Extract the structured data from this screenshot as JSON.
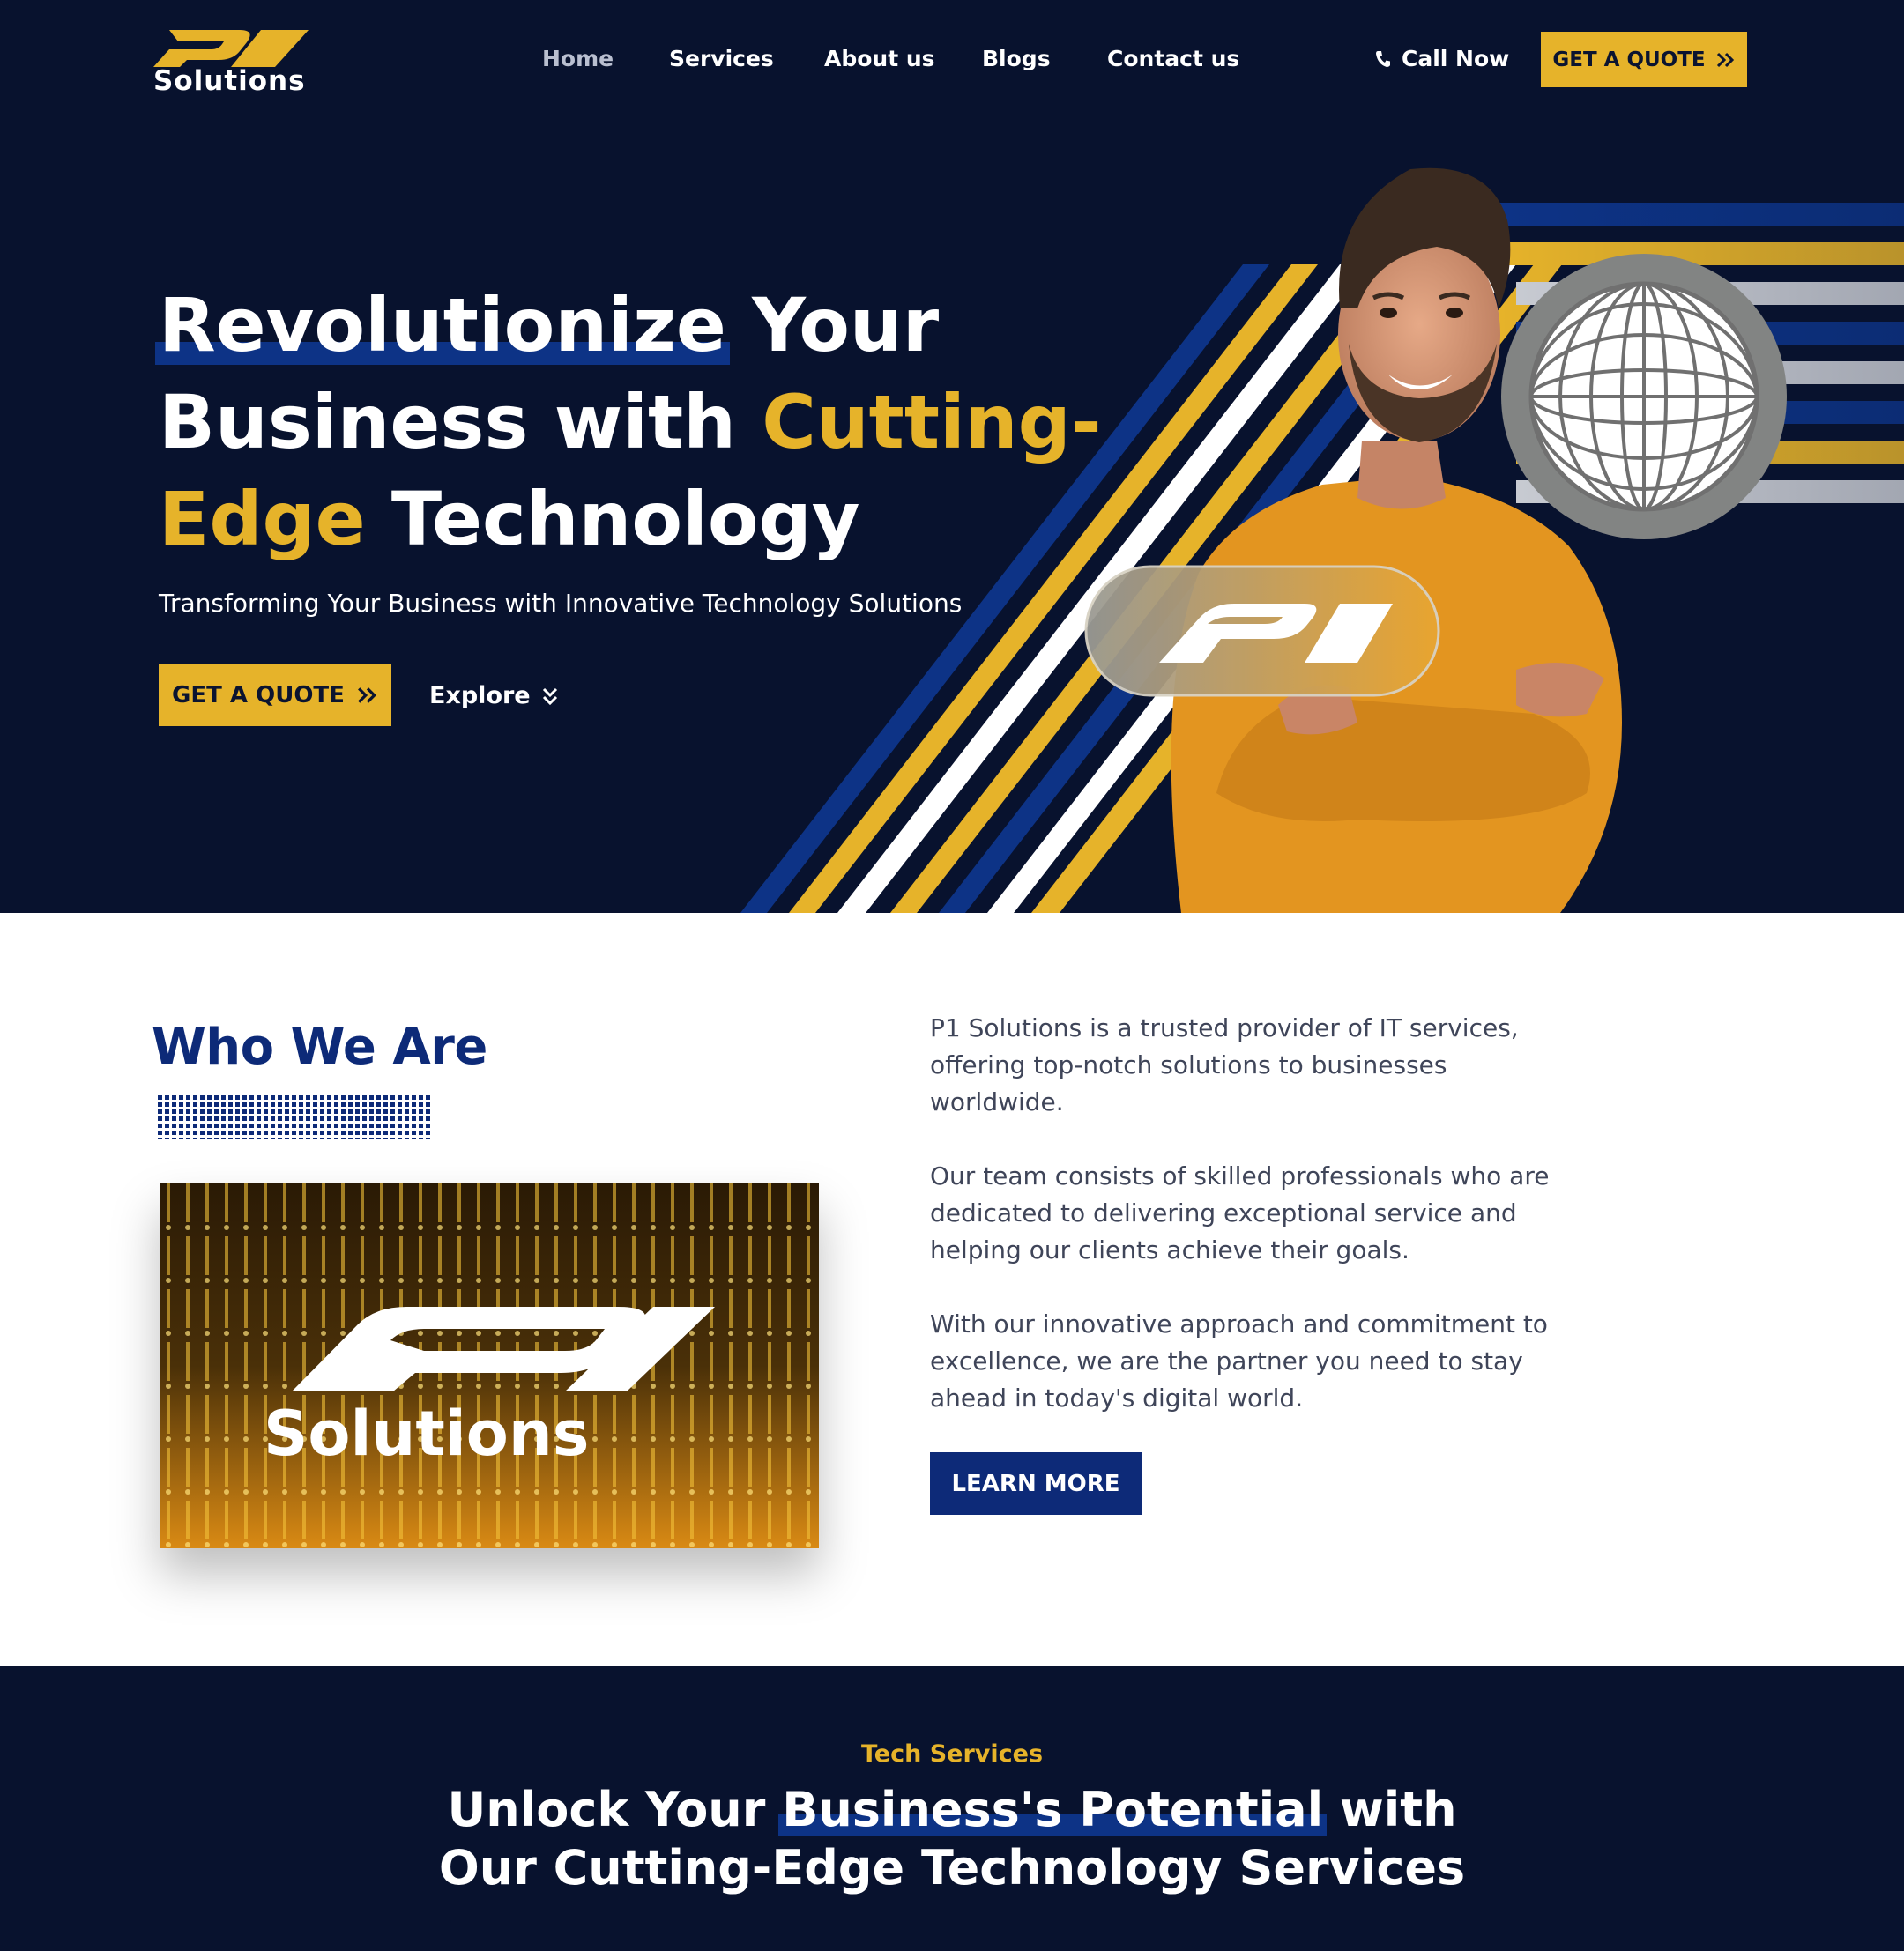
{
  "brand": {
    "logo_text": "Solutions",
    "gold": "#e6b32a",
    "navy": "#08122e",
    "blue": "#0d2a78"
  },
  "nav": {
    "items": [
      {
        "label": "Home",
        "active": true
      },
      {
        "label": "Services",
        "active": false
      },
      {
        "label": "About us",
        "active": false
      },
      {
        "label": "Blogs",
        "active": false
      },
      {
        "label": "Contact us",
        "active": false
      }
    ],
    "call_now": "Call Now",
    "quote_button": "GET A QUOTE",
    "phone_icon": "phone-icon",
    "chevrons_icon": "double-chevron-right-icon"
  },
  "hero": {
    "title_line1_highlight": "Revolutionize",
    "title_line1_rest": " Your",
    "title_line2_plain": "Business with ",
    "title_line2_gold": "Cutting-",
    "title_line3_gold": "Edge",
    "title_line3_rest": " Technology",
    "subtitle": "Transforming Your Business with Innovative Technology Solutions",
    "quote_button": "GET A QUOTE",
    "explore_link": "Explore"
  },
  "who_we_are": {
    "title": "Who We Are",
    "image_text": "Solutions",
    "paragraphs": [
      "P1 Solutions is a trusted provider of IT services, offering top-notch solutions to businesses worldwide.",
      "Our team consists of skilled professionals who are dedicated to delivering exceptional service and helping our clients achieve their goals.",
      "With our innovative approach and commitment to excellence, we are the partner you need to stay ahead in today's digital world."
    ],
    "learn_more": "LEARN MORE"
  },
  "services": {
    "eyebrow": "Tech Services",
    "title_pre": "Unlock Your ",
    "title_highlight": "Business's Potential",
    "title_post": " with",
    "title_line2": "Our Cutting-Edge Technology Services"
  }
}
